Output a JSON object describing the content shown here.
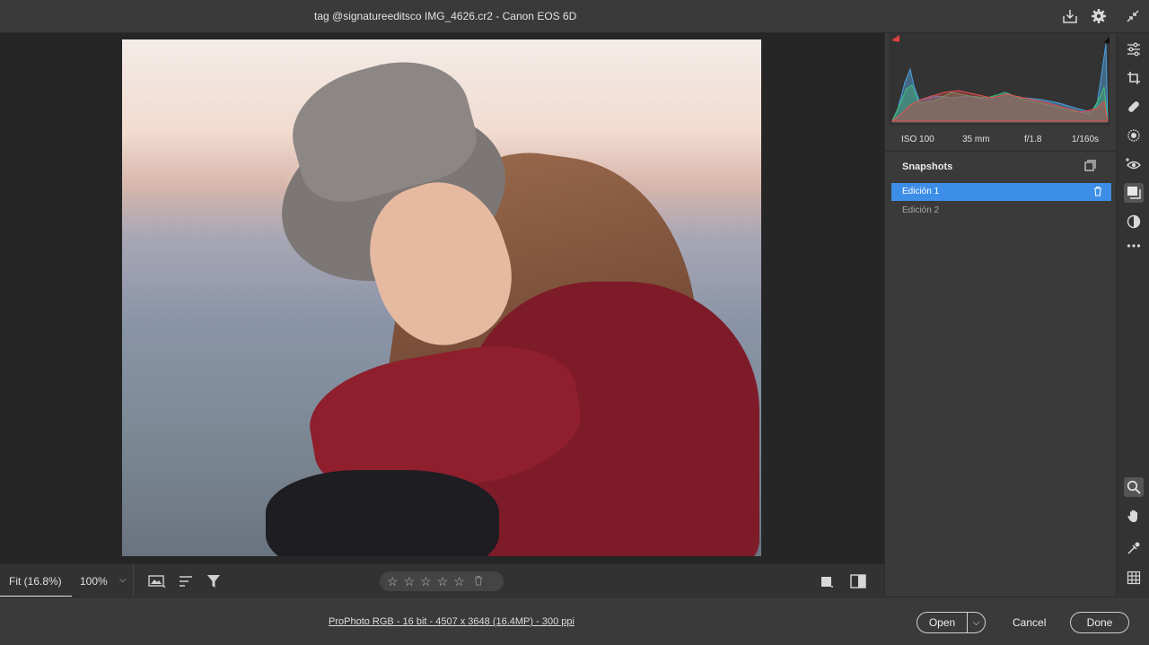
{
  "titlebar": {
    "title": "tag @signatureeditsco IMG_4626.cr2  -  Canon EOS 6D",
    "icons": [
      "save-icon",
      "gear-icon",
      "collapse-icon"
    ]
  },
  "canvas_toolbar": {
    "zoom_fit": "Fit (16.8%)",
    "zoom_100": "100%",
    "icons": [
      "background-options-icon",
      "sort-icon",
      "filter-icon",
      "overlay-icon",
      "compare-icon"
    ],
    "stars": [
      "☆",
      "☆",
      "☆",
      "☆",
      "☆"
    ]
  },
  "status": {
    "workflow_link": "ProPhoto RGB - 16 bit - 4507 x 3648 (16.4MP) - 300 ppi",
    "open_label": "Open",
    "cancel_label": "Cancel",
    "done_label": "Done"
  },
  "panel": {
    "histogram": {
      "channels": [
        "red",
        "green",
        "blue"
      ]
    },
    "exif": {
      "iso": "ISO 100",
      "focal": "35 mm",
      "aperture": "f/1.8",
      "shutter": "1/160s"
    },
    "snapshots": {
      "title": "Snapshots",
      "items": [
        {
          "label": "Edición 1",
          "active": true
        },
        {
          "label": "Edición 2",
          "active": false
        }
      ]
    }
  },
  "toolstrip": {
    "top_tools": [
      "edit-sliders-icon",
      "crop-icon",
      "healing-icon",
      "masking-icon",
      "red-eye-icon",
      "snapshots-icon",
      "presets-icon",
      "more-icon"
    ],
    "bottom_tools": [
      "zoom-icon",
      "hand-icon",
      "color-sampler-icon",
      "grid-icon"
    ],
    "selected": "snapshots-icon"
  },
  "colors": {
    "accent": "#3d8ee6",
    "panel_bg": "#3a3a3a",
    "canvas_bg": "#262626"
  }
}
